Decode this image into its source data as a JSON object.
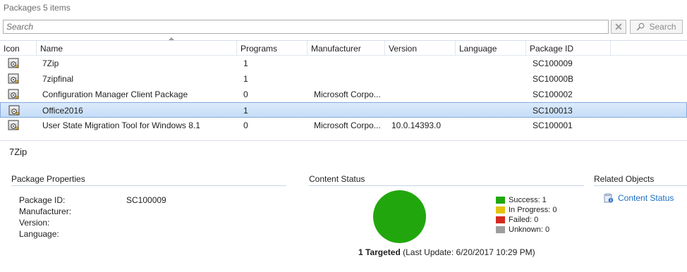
{
  "header": {
    "title": "Packages",
    "count": "5 items"
  },
  "search": {
    "placeholder": "Search",
    "value": "",
    "button_label": "Search"
  },
  "columns": [
    "Icon",
    "Name",
    "Programs",
    "Manufacturer",
    "Version",
    "Language",
    "Package ID"
  ],
  "rows": [
    {
      "name": "7Zip",
      "programs": "1",
      "manufacturer": "",
      "version": "",
      "language": "",
      "package_id": "SC100009",
      "selected": false
    },
    {
      "name": "7zipfinal",
      "programs": "1",
      "manufacturer": "",
      "version": "",
      "language": "",
      "package_id": "SC10000B",
      "selected": false
    },
    {
      "name": "Configuration Manager Client Package",
      "programs": "0",
      "manufacturer": "Microsoft Corpo...",
      "version": "",
      "language": "",
      "package_id": "SC100002",
      "selected": false
    },
    {
      "name": "Office2016",
      "programs": "1",
      "manufacturer": "",
      "version": "",
      "language": "",
      "package_id": "SC100013",
      "selected": true
    },
    {
      "name": "User State Migration Tool for Windows 8.1",
      "programs": "0",
      "manufacturer": "Microsoft Corpo...",
      "version": "10.0.14393.0",
      "language": "",
      "package_id": "SC100001",
      "selected": false
    }
  ],
  "details": {
    "title": "7Zip",
    "package_properties": {
      "heading": "Package Properties",
      "labels": [
        "Package ID:",
        "Manufacturer:",
        "Version:",
        "Language:"
      ],
      "values": [
        "SC100009",
        "",
        "",
        ""
      ]
    },
    "content_status": {
      "heading": "Content Status",
      "legend": [
        {
          "label": "Success: 1",
          "color": "#21a70d"
        },
        {
          "label": "In Progress: 0",
          "color": "#e3c30f"
        },
        {
          "label": "Failed: 0",
          "color": "#d42a1f"
        },
        {
          "label": "Unknown: 0",
          "color": "#9e9e9e"
        }
      ],
      "targeted": "1 Targeted",
      "last_update": "(Last Update: 6/20/2017 10:29 PM)"
    },
    "related_objects": {
      "heading": "Related Objects",
      "link_label": "Content Status"
    }
  },
  "icons": {
    "package": "package-icon",
    "clear": "clear-icon",
    "search": "search-icon",
    "content-status": "content-status-icon"
  }
}
